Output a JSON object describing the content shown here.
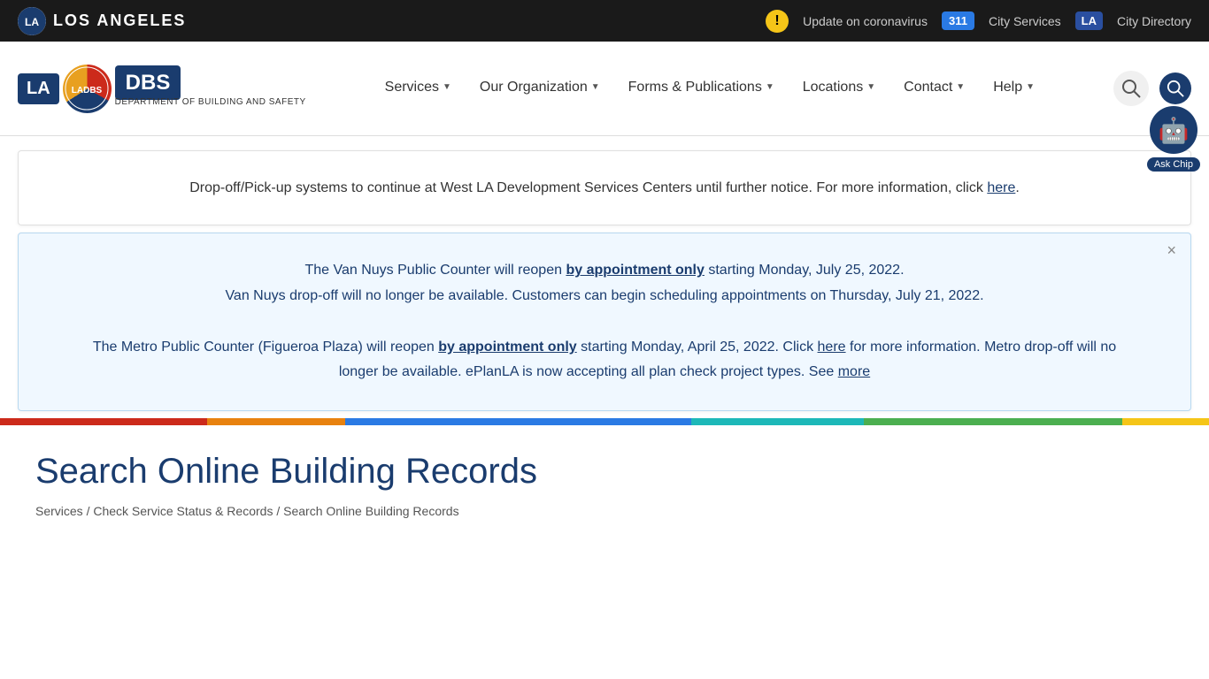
{
  "topbar": {
    "logo_text": "LOS ANGELES",
    "alert_symbol": "!",
    "update_label": "Update on coronavirus",
    "badge_311": "311",
    "city_services_label": "City Services",
    "badge_la": "LA",
    "city_directory_label": "City Directory"
  },
  "navbar": {
    "logo_la": "LA",
    "logo_dbs": "DBS",
    "logo_subtitle": "DEPARTMENT OF BUILDING AND SAFETY",
    "menu_items": [
      {
        "label": "Services",
        "has_dropdown": true
      },
      {
        "label": "Our Organization",
        "has_dropdown": true
      },
      {
        "label": "Forms & Publications",
        "has_dropdown": true
      },
      {
        "label": "Locations",
        "has_dropdown": true
      },
      {
        "label": "Contact",
        "has_dropdown": true
      },
      {
        "label": "Help",
        "has_dropdown": true
      }
    ]
  },
  "announcement1": {
    "text_main": "Drop-off/Pick-up systems to continue at West LA Development Services Centers until further notice. For more information, click",
    "link_text": "here",
    "text_end": "."
  },
  "announcement2": {
    "para1_start": "The Van Nuys Public Counter will reopen ",
    "para1_link": "by appointment only",
    "para1_end": " starting Monday, July 25, 2022.\nVan Nuys drop-off will no longer be available. Customers can begin scheduling appointments on Thursday, July 21, 2022.",
    "para2_start": "The Metro Public Counter (Figueroa Plaza) will reopen ",
    "para2_link": "by appointment only",
    "para2_middle": " starting Monday, April 25, 2022. Click ",
    "para2_link2": "here",
    "para2_end": " for more information. Metro drop-off will no longer be available. ePlanLA is now accepting all plan check project types. See ",
    "para2_link3": "more",
    "close_label": "×"
  },
  "page": {
    "title": "Search Online Building Records",
    "breadcrumb": {
      "item1": "Services",
      "separator1": " / ",
      "item2": "Check Service Status & Records",
      "separator2": " / ",
      "item3": "Search Online Building Records"
    }
  },
  "askchip": {
    "icon": "🤖",
    "label": "Ask Chip"
  },
  "colors": {
    "accent_blue": "#1a3c6e",
    "accent_red": "#cc2a1b",
    "accent_orange": "#e8820f",
    "accent_teal": "#1db8b8",
    "accent_green": "#4caf50",
    "accent_yellow": "#f5c518"
  }
}
